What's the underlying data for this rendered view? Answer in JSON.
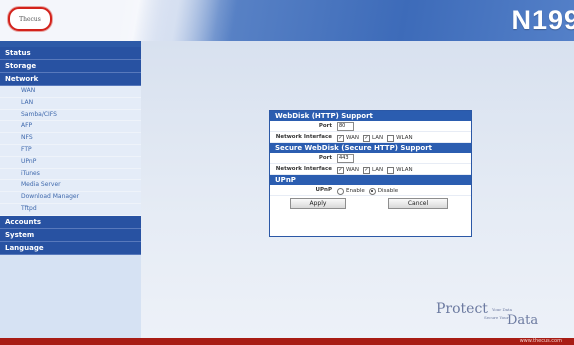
{
  "header": {
    "logo_text": "Thecus",
    "model": "N199"
  },
  "sidebar": {
    "categories": [
      {
        "label": "Status"
      },
      {
        "label": "Storage"
      },
      {
        "label": "Network"
      },
      {
        "label": "Accounts"
      },
      {
        "label": "System"
      },
      {
        "label": "Language"
      }
    ],
    "network_items": [
      {
        "label": "WAN"
      },
      {
        "label": "LAN"
      },
      {
        "label": "Samba/CIFS"
      },
      {
        "label": "AFP"
      },
      {
        "label": "NFS"
      },
      {
        "label": "FTP"
      },
      {
        "label": "UPnP"
      },
      {
        "label": "iTunes"
      },
      {
        "label": "Media Server"
      },
      {
        "label": "Download Manager"
      },
      {
        "label": "Tftpd"
      }
    ]
  },
  "panel": {
    "webdisk": {
      "title": "WebDisk (HTTP) Support",
      "port_label": "Port",
      "port_value": "80",
      "iface_label": "Network Interface",
      "iface_options": [
        "WAN",
        "LAN",
        "WLAN"
      ]
    },
    "secure_webdisk": {
      "title": "Secure WebDisk (Secure HTTP) Support",
      "port_label": "Port",
      "port_value": "443",
      "iface_label": "Network Interface",
      "iface_options": [
        "WAN",
        "LAN",
        "WLAN"
      ]
    },
    "upnp": {
      "title": "UPnP",
      "label": "UPnP",
      "enable": "Enable",
      "disable": "Disable"
    },
    "apply": "Apply",
    "cancel": "Cancel"
  },
  "brand": {
    "protect": "Protect",
    "your_data": "Your Data",
    "secure_your": "Secure Your",
    "data": "Data",
    "url": "www.thecus.com"
  }
}
